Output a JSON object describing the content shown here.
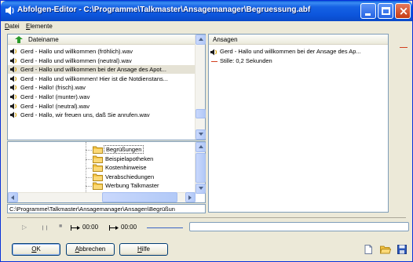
{
  "window": {
    "title": "Abfolgen-Editor - C:\\Programme\\Talkmaster\\Ansagemanager\\Begruessung.abf"
  },
  "menu": {
    "items": [
      {
        "label": "Datei",
        "underline_index": 0
      },
      {
        "label": "Elemente",
        "underline_index": 0
      }
    ]
  },
  "files_panel": {
    "header": "Dateiname",
    "rows": [
      "Gerd - Hallo und willkommen (fröhlich).wav",
      "Gerd - Hallo und willkommen (neutral).wav",
      "Gerd - Hallo und willkommen bei der Ansage des Apot...",
      "Gerd - Hallo und willkommen! Hier ist die Notdienstans...",
      "Gerd - Hallo! (frisch).wav",
      "Gerd - Hallo! (munter).wav",
      "Gerd - Hallo! (neutral).wav",
      "Gerd - Hallo, wir freuen uns, daß Sie anrufen.wav"
    ],
    "selected_index": 2
  },
  "folder_tree": {
    "items": [
      "Begrüßungen",
      "Beispielapotheken",
      "Kostenhinweise",
      "Verabschiedungen",
      "Werbung Talkmaster"
    ],
    "selected_index": 0
  },
  "path": "C:\\Programme\\Talkmaster\\Ansagemanager\\Ansagen\\Begrüßun",
  "sequence_panel": {
    "header": "Ansagen",
    "items": [
      {
        "type": "audio",
        "label": "Gerd - Hallo und willkommen bei der Ansage des Ap..."
      },
      {
        "type": "silence",
        "label": "Stille: 0,2 Sekunden"
      }
    ]
  },
  "transport": {
    "play_symbol": "▷",
    "pause_symbol": "❙❙",
    "stop_symbol": "■",
    "position_time": "00:00",
    "length_time": "00:00",
    "progress": 0
  },
  "buttons": {
    "ok": {
      "label": "OK",
      "underline": "O",
      "rest": "K"
    },
    "cancel": {
      "label": "Abbrechen",
      "underline": "A",
      "rest": "bbrechen"
    },
    "help": {
      "label": "Hilfe",
      "underline": "H",
      "rest": "ilfe"
    }
  },
  "colors": {
    "titlebar": "#0a5ad8",
    "window_bg": "#ece9d8",
    "selection": "#e5e2d5",
    "folder": "#f5c342",
    "silence_line": "#d24020"
  },
  "icons": {
    "app": "speaker-icon",
    "files_header": "green-arrow-icon",
    "row": "speaker-icon",
    "folder": "folder-icon",
    "toolbar": [
      "new-document-icon",
      "open-folder-icon",
      "save-disk-icon"
    ]
  }
}
